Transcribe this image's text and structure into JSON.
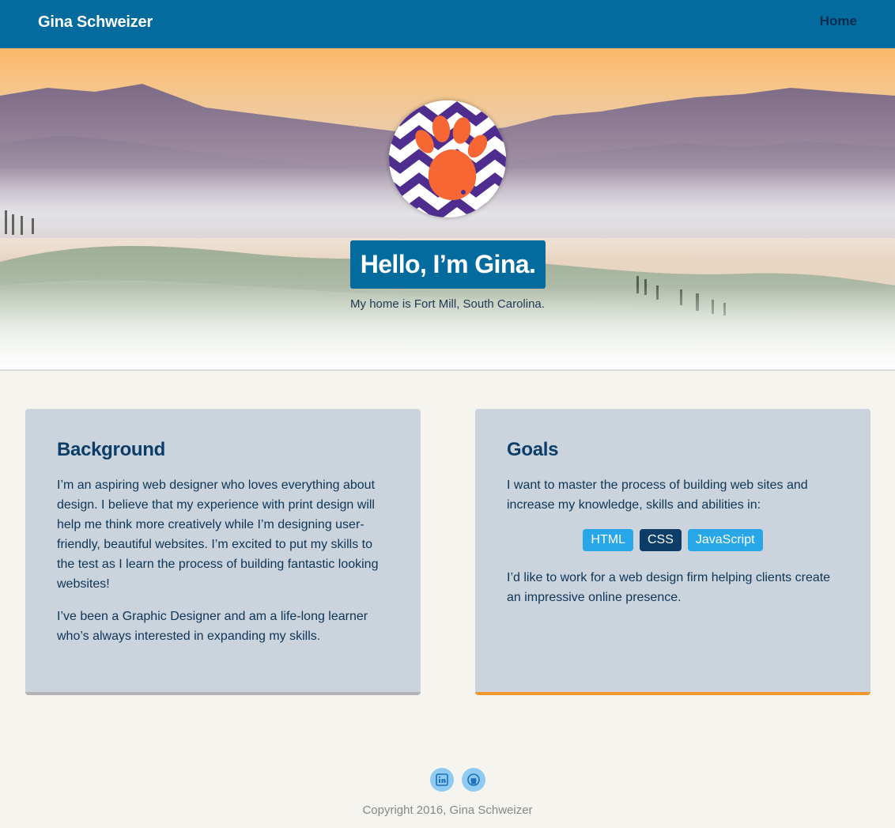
{
  "header": {
    "brand": "Gina Schweizer",
    "nav": {
      "home": "Home"
    }
  },
  "hero": {
    "avatar_icon": "clemson-paw-icon",
    "greeting": "Hello, I’m Gina.",
    "location": "My home is Fort Mill, South Carolina."
  },
  "background": {
    "title": "Background",
    "paragraphs": [
      "I’m an aspiring web designer who loves everything about design. I believe that my experience with print design will help me think more creatively while I’m designing user-friendly, beautiful websites. I’m excited to put my skills to the test as I learn the process of building fantastic looking websites!",
      "I’ve been a Graphic Designer and am a life-long learner who’s always interested in expanding my skills."
    ]
  },
  "goals": {
    "title": "Goals",
    "intro": "I want to master the process of building web sites and increase my knowledge, skills and abilities in:",
    "skills": [
      "HTML",
      "CSS",
      "JavaScript"
    ],
    "outro": "I’d like to work for a web design firm helping clients create an impressive online presence."
  },
  "footer": {
    "social": [
      "linkedin-icon",
      "github-icon"
    ],
    "copyright": "Copyright 2016, Gina Schweizer"
  },
  "colors": {
    "primary": "#046b9e",
    "dark_blue": "#0b3d68",
    "light_blue": "#28a7e8",
    "card_bg": "#cbd3dd",
    "accent_orange": "#f2962d",
    "page_bg": "#f5f4ef"
  }
}
